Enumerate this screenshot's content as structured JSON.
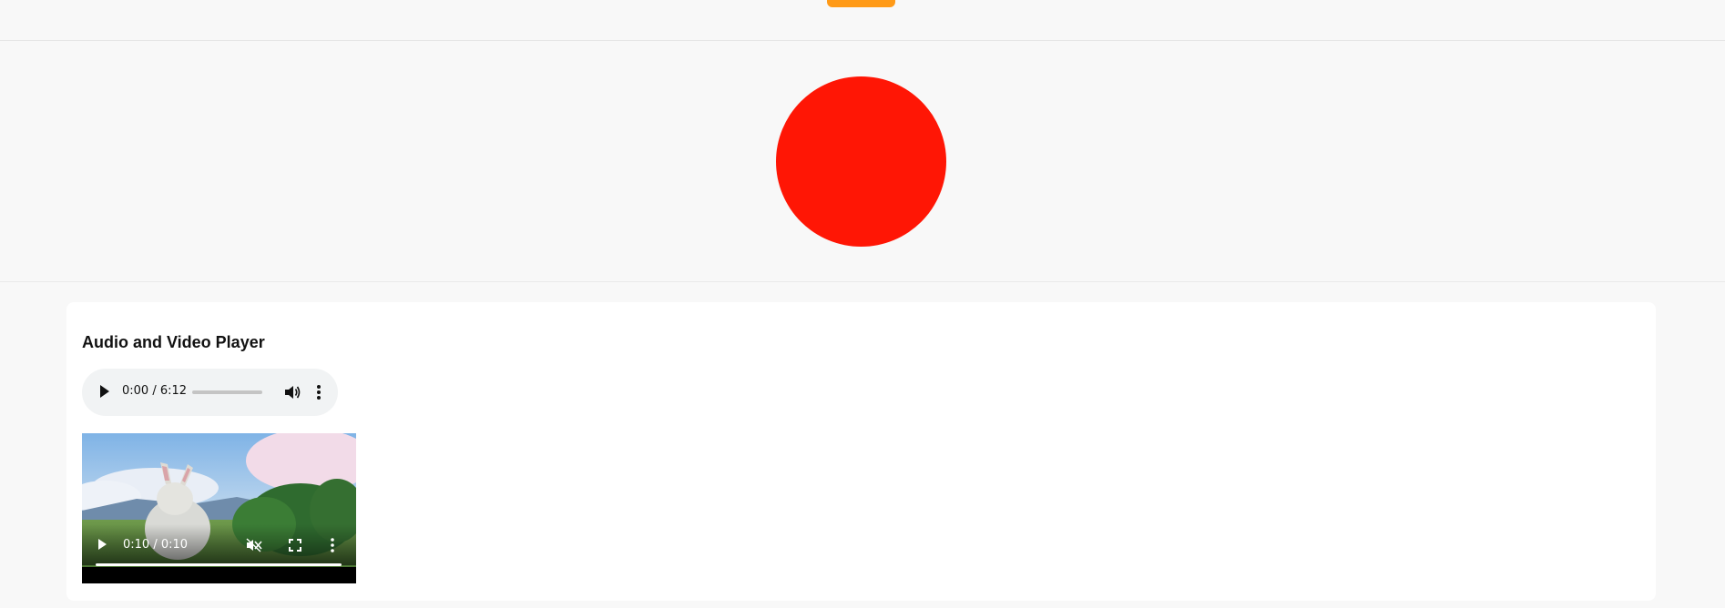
{
  "colors": {
    "accent_orange": "#ff9a17",
    "circle_red": "#ff1605",
    "page_bg": "#f8f8f8",
    "card_bg": "#ffffff"
  },
  "player": {
    "title": "Audio and Video Player",
    "audio": {
      "time": "0:00 / 6:12",
      "progress_fraction": 0,
      "icons": [
        "play-icon",
        "volume-icon",
        "more-options-icon"
      ]
    },
    "video": {
      "time": "0:10 / 0:10",
      "progress_fraction": 1,
      "muted": true,
      "icons": [
        "play-icon",
        "muted-volume-icon",
        "fullscreen-icon",
        "more-options-icon"
      ]
    }
  }
}
